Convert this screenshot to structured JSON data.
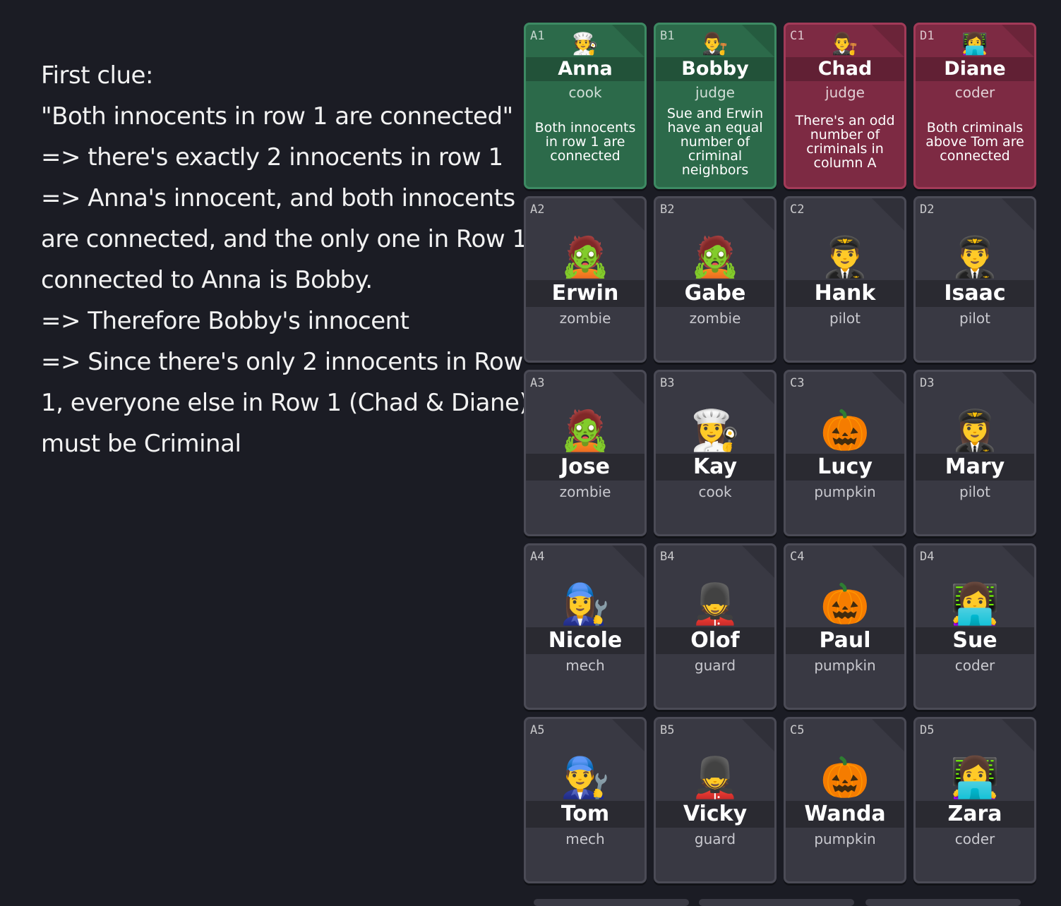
{
  "notes": [
    "First clue:",
    "\"Both innocents in row 1 are connected\"",
    "=> there's exactly 2 innocents in row 1",
    "=> Anna's innocent, and both innocents",
    "are connected, and the only one in Row 1",
    "connected to Anna is Bobby.",
    "=> Therefore Bobby's innocent",
    "=> Since there's only 2 innocents in Row",
    "1, everyone else in Row 1 (Chad & Diane)",
    "must be Criminal"
  ],
  "colors": {
    "background": "#1b1c24",
    "card": "#393943",
    "innocent": "#2c6a4a",
    "criminal": "#7d2a43"
  },
  "cards": [
    {
      "coord": "A1",
      "emoji": "🧑‍🍳",
      "icon": "cook-icon",
      "name": "Anna",
      "role": "cook",
      "status": "innocent",
      "hint": "Both innocents in row 1 are connected"
    },
    {
      "coord": "B1",
      "emoji": "👨‍⚖️",
      "icon": "judge-icon",
      "name": "Bobby",
      "role": "judge",
      "status": "innocent",
      "hint": "Sue and Erwin have an equal number of criminal neighbors"
    },
    {
      "coord": "C1",
      "emoji": "👨‍⚖️",
      "icon": "judge-icon",
      "name": "Chad",
      "role": "judge",
      "status": "criminal",
      "hint": "There's an odd number of criminals in column A"
    },
    {
      "coord": "D1",
      "emoji": "👩‍💻",
      "icon": "coder-icon",
      "name": "Diane",
      "role": "coder",
      "status": "criminal",
      "hint": "Both criminals above Tom are connected"
    },
    {
      "coord": "A2",
      "emoji": "🧟",
      "icon": "zombie-icon",
      "name": "Erwin",
      "role": "zombie",
      "status": "unknown",
      "hint": ""
    },
    {
      "coord": "B2",
      "emoji": "🧟",
      "icon": "zombie-icon",
      "name": "Gabe",
      "role": "zombie",
      "status": "unknown",
      "hint": ""
    },
    {
      "coord": "C2",
      "emoji": "👨‍✈️",
      "icon": "pilot-icon",
      "name": "Hank",
      "role": "pilot",
      "status": "unknown",
      "hint": ""
    },
    {
      "coord": "D2",
      "emoji": "👨‍✈️",
      "icon": "pilot-icon",
      "name": "Isaac",
      "role": "pilot",
      "status": "unknown",
      "hint": ""
    },
    {
      "coord": "A3",
      "emoji": "🧟",
      "icon": "zombie-icon",
      "name": "Jose",
      "role": "zombie",
      "status": "unknown",
      "hint": ""
    },
    {
      "coord": "B3",
      "emoji": "👩‍🍳",
      "icon": "cook-icon",
      "name": "Kay",
      "role": "cook",
      "status": "unknown",
      "hint": ""
    },
    {
      "coord": "C3",
      "emoji": "🎃",
      "icon": "pumpkin-icon",
      "name": "Lucy",
      "role": "pumpkin",
      "status": "unknown",
      "hint": ""
    },
    {
      "coord": "D3",
      "emoji": "👩‍✈️",
      "icon": "pilot-icon",
      "name": "Mary",
      "role": "pilot",
      "status": "unknown",
      "hint": ""
    },
    {
      "coord": "A4",
      "emoji": "👩‍🔧",
      "icon": "mechanic-icon",
      "name": "Nicole",
      "role": "mech",
      "status": "unknown",
      "hint": ""
    },
    {
      "coord": "B4",
      "emoji": "💂",
      "icon": "guard-icon",
      "name": "Olof",
      "role": "guard",
      "status": "unknown",
      "hint": ""
    },
    {
      "coord": "C4",
      "emoji": "🎃",
      "icon": "pumpkin-icon",
      "name": "Paul",
      "role": "pumpkin",
      "status": "unknown",
      "hint": ""
    },
    {
      "coord": "D4",
      "emoji": "👩‍💻",
      "icon": "coder-icon",
      "name": "Sue",
      "role": "coder",
      "status": "unknown",
      "hint": ""
    },
    {
      "coord": "A5",
      "emoji": "👨‍🔧",
      "icon": "mechanic-icon",
      "name": "Tom",
      "role": "mech",
      "status": "unknown",
      "hint": ""
    },
    {
      "coord": "B5",
      "emoji": "💂",
      "icon": "guard-icon",
      "name": "Vicky",
      "role": "guard",
      "status": "unknown",
      "hint": ""
    },
    {
      "coord": "C5",
      "emoji": "🎃",
      "icon": "pumpkin-icon",
      "name": "Wanda",
      "role": "pumpkin",
      "status": "unknown",
      "hint": ""
    },
    {
      "coord": "D5",
      "emoji": "👩‍💻",
      "icon": "coder-icon",
      "name": "Zara",
      "role": "coder",
      "status": "unknown",
      "hint": ""
    }
  ]
}
